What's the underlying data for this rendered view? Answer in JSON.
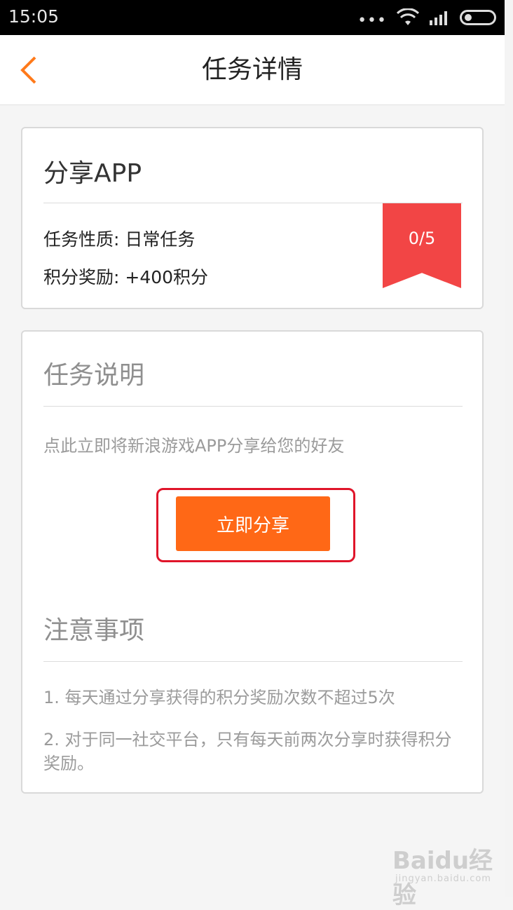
{
  "status_bar": {
    "time": "15:05",
    "icons": [
      "more-dots-icon",
      "wifi-icon",
      "signal-icon",
      "battery-icon"
    ]
  },
  "header": {
    "title": "任务详情",
    "back_icon": "chevron-left-icon",
    "accent_color": "#ff7a1a"
  },
  "task": {
    "name": "分享APP",
    "nature_line": "任务性质: 日常任务",
    "reward_line": "积分奖励: +400积分",
    "progress_text": "0/5",
    "progress_fraction": 0,
    "ribbon_color": "#f24545"
  },
  "description": {
    "title": "任务说明",
    "text": "点此立即将新浪游戏APP分享给您的好友",
    "button_label": "立即分享",
    "button_color": "#ff6816"
  },
  "notes": {
    "title": "注意事项",
    "items": [
      "1. 每天通过分享获得的积分奖励次数不超过5次",
      "2. 对于同一社交平台，只有每天前两次分享时获得积分奖励。"
    ]
  },
  "watermark": {
    "logo_text": "Baidu经验",
    "sub_text": "jingyan.baidu.com"
  }
}
